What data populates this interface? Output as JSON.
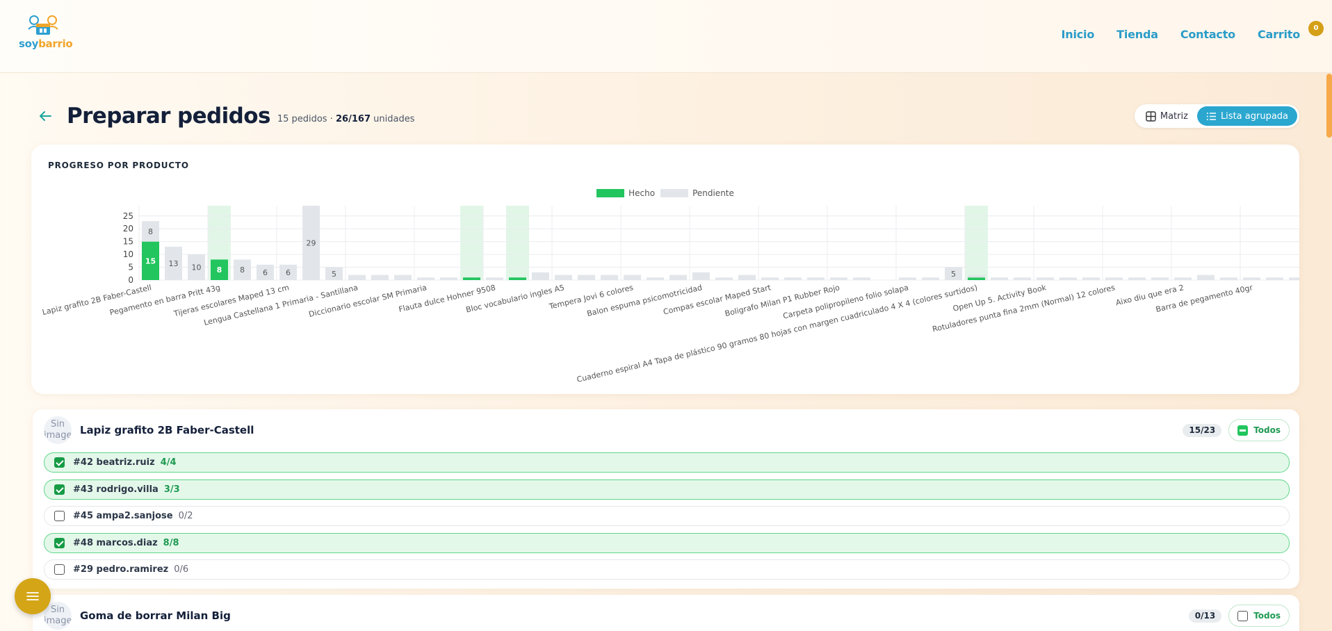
{
  "brand": {
    "part1": "soy",
    "part2": "barrio"
  },
  "nav": {
    "items": [
      "Inicio",
      "Tienda",
      "Contacto",
      "Carrito"
    ],
    "cart_count": "0"
  },
  "page": {
    "title": "Preparar pedidos",
    "orders": "15 pedidos",
    "sep": "·",
    "units_done": "26/167",
    "units_label": "unidades"
  },
  "view_toggle": {
    "matrix": "Matriz",
    "grouped": "Lista agrupada"
  },
  "chart": {
    "heading": "PROGRESO POR PRODUCTO",
    "legend_done": "Hecho",
    "legend_pending": "Pendiente"
  },
  "chart_data": {
    "type": "bar",
    "stacked": true,
    "ylim": [
      0,
      29
    ],
    "yticks": [
      0,
      5,
      10,
      15,
      20,
      25
    ],
    "grid": true,
    "legend_position": "top-center",
    "series": [
      {
        "name": "Hecho",
        "color": "#22c55e",
        "values": [
          15,
          0,
          0,
          8,
          0,
          0,
          0,
          0,
          0,
          0,
          0,
          0,
          0,
          0,
          1,
          0,
          1,
          0,
          0,
          0,
          0,
          0,
          0,
          0,
          0,
          0,
          0,
          0,
          0,
          0,
          0,
          0,
          0,
          0,
          0,
          0,
          1,
          0,
          0,
          0,
          0,
          0,
          0,
          0,
          0,
          0,
          0,
          0,
          0,
          0,
          0,
          0,
          0
        ]
      },
      {
        "name": "Pendiente",
        "color": "#e2e6ea",
        "values": [
          8,
          13,
          10,
          0,
          8,
          6,
          6,
          29,
          5,
          2,
          2,
          2,
          1,
          1,
          0,
          1,
          0,
          3,
          2,
          2,
          2,
          2,
          1,
          2,
          3,
          1,
          2,
          1,
          1,
          1,
          1,
          1,
          0,
          1,
          1,
          5,
          1,
          1,
          1,
          1,
          1,
          1,
          1,
          1,
          1,
          1,
          2,
          1,
          1,
          1,
          1,
          1,
          1
        ]
      }
    ],
    "complete_indices": [
      3,
      14,
      16,
      36
    ],
    "data_labels": [
      {
        "i": 0,
        "series": "Pendiente",
        "text": "8"
      },
      {
        "i": 0,
        "series": "Hecho",
        "text": "15"
      },
      {
        "i": 1,
        "series": "Pendiente",
        "text": "13"
      },
      {
        "i": 2,
        "series": "Pendiente",
        "text": "10"
      },
      {
        "i": 3,
        "series": "Hecho",
        "text": "8"
      },
      {
        "i": 4,
        "series": "Pendiente",
        "text": "8"
      },
      {
        "i": 5,
        "series": "Pendiente",
        "text": "6"
      },
      {
        "i": 6,
        "series": "Pendiente",
        "text": "6"
      },
      {
        "i": 7,
        "series": "Pendiente",
        "text": "29"
      },
      {
        "i": 8,
        "series": "Pendiente",
        "text": "5"
      },
      {
        "i": 35,
        "series": "Pendiente",
        "text": "5"
      }
    ],
    "category_labels": [
      {
        "i": 0,
        "text": "Lapiz grafito 2B Faber-Castell"
      },
      {
        "i": 3,
        "text": "Pegamento en barra Pritt 43g"
      },
      {
        "i": 6,
        "text": "Tijeras escolares Maped 13 cm"
      },
      {
        "i": 9,
        "text": "Lengua Castellana 1 Primaria - Santillana"
      },
      {
        "i": 12,
        "text": "Diccionario escolar SM Primaria"
      },
      {
        "i": 15,
        "text": "Flauta dulce Hohner 9508"
      },
      {
        "i": 18,
        "text": "Bloc vocabulario ingles A5"
      },
      {
        "i": 21,
        "text": "Tempera Jovi 6 colores"
      },
      {
        "i": 24,
        "text": "Balon espuma psicomotricidad"
      },
      {
        "i": 27,
        "text": "Compas escolar Maped Start"
      },
      {
        "i": 30,
        "text": "Boligrafo Milan P1 Rubber Rojo"
      },
      {
        "i": 33,
        "text": "Carpeta polipropileno folio solapa"
      },
      {
        "i": 36,
        "text": "Cuaderno espiral A4 Tapa de plástico 90 gramos 80 hojas con margen cuadriculado 4 X 4 (colores surtidos)"
      },
      {
        "i": 39,
        "text": "Open Up 5. Activity Book"
      },
      {
        "i": 42,
        "text": "Rotuladores punta fina 2mm (Normal) 12 colores"
      },
      {
        "i": 45,
        "text": "Aixo diu que era 2"
      },
      {
        "i": 48,
        "text": "Barra de pegamento 40gr"
      }
    ]
  },
  "groups": [
    {
      "thumb": "Sin imagen",
      "name": "Lapiz grafito 2B Faber-Castell",
      "count": "15/23",
      "todos": "Todos",
      "orders": [
        {
          "label": "#42 beatriz.ruiz",
          "count": "4/4",
          "done": true
        },
        {
          "label": "#43 rodrigo.villa",
          "count": "3/3",
          "done": true
        },
        {
          "label": "#45 ampa2.sanjose",
          "count": "0/2",
          "done": false
        },
        {
          "label": "#48 marcos.diaz",
          "count": "8/8",
          "done": true
        },
        {
          "label": "#29 pedro.ramirez",
          "count": "0/6",
          "done": false
        }
      ]
    },
    {
      "thumb": "Sin imagen",
      "name": "Goma de borrar Milan Big",
      "count": "0/13",
      "todos": "Todos",
      "orders": []
    }
  ],
  "icons": {
    "back": "arrow-left-icon",
    "matrix": "grid-icon",
    "list": "list-icon",
    "menu": "menu-icon"
  }
}
